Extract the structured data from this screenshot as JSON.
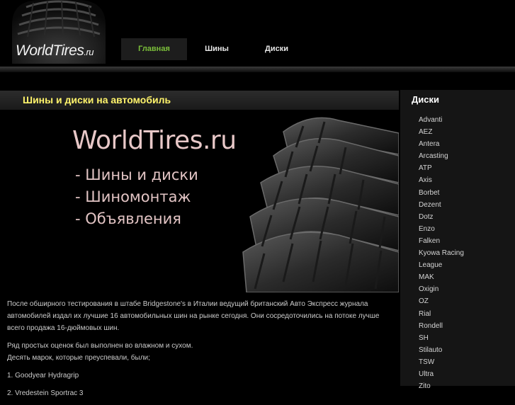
{
  "logo": {
    "brand": "WorldTires",
    "suffix": ".ru"
  },
  "nav": {
    "items": [
      "Главная",
      "Шины",
      "Диски"
    ],
    "active": "Главная"
  },
  "main": {
    "title": "Шины и диски на автомобиль"
  },
  "banner": {
    "headline": "WorldTires.ru",
    "lines": [
      "- Шины и диски",
      "- Шиномонтаж",
      "- Объявления"
    ]
  },
  "article": {
    "p1": "После обширного тестирования в штабе Bridgestone's в Италии ведущий британский Авто Экспресс журнала автомобилей издал их лучшие 16 автомобильных шин на рынке сегодня. Они сосредоточились на потоке лучше всего продажа 16-дюймовых шин.",
    "p2a": "Ряд простых оценок был выполнен во влажном и сухом.",
    "p2b": "Десять марок, которые преуспевали, были;",
    "p3": "1. Goodyear Hydragrip",
    "p4": "2. Vredestein Sportrac 3"
  },
  "sidebar": {
    "title": "Диски",
    "items": [
      "Advanti",
      "AEZ",
      "Antera",
      "Arcasting",
      "ATP",
      "Axis",
      "Borbet",
      "Dezent",
      "Dotz",
      "Enzo",
      "Falken",
      "Kyowa Racing",
      "League",
      "MAK",
      "Oxigin",
      "OZ",
      "Rial",
      "Rondell",
      "SH",
      "Stilauto",
      "TSW",
      "Ultra",
      "Zito"
    ]
  },
  "colors": {
    "accent_green": "#7bbf3a",
    "title_yellow": "#fff36b",
    "background": "#000000",
    "sidebar_bg": "#151515"
  },
  "icons": [
    "tire-logo-icon",
    "tire-stack-icon"
  ]
}
